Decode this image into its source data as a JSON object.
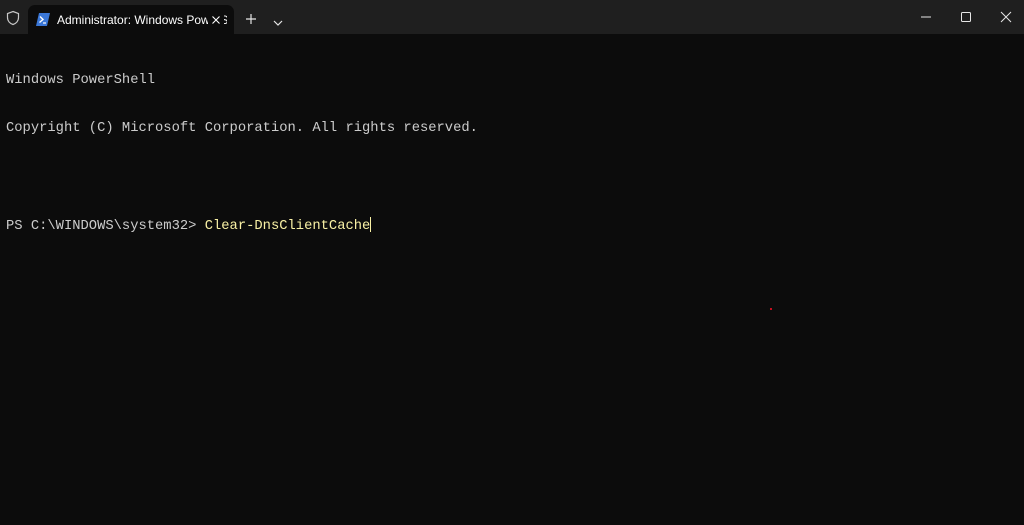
{
  "tab": {
    "title": "Administrator: Windows PowerShell"
  },
  "console": {
    "line1": "Windows PowerShell",
    "line2": "Copyright (C) Microsoft Corporation. All rights reserved.",
    "prompt": "PS C:\\WINDOWS\\system32> ",
    "command": "Clear-DnsClientCache"
  },
  "icons": {
    "shield": "shield-icon",
    "powershell": "powershell-icon",
    "tab_close": "close-icon",
    "new_tab": "plus-icon",
    "dropdown": "chevron-down-icon",
    "minimize": "minimize-icon",
    "maximize": "maximize-icon",
    "close": "close-icon"
  },
  "colors": {
    "background": "#0c0c0c",
    "titlebar": "#1f1f1f",
    "text": "#cccccc",
    "command": "#f9f1a5",
    "accent": "#3a77d8"
  }
}
